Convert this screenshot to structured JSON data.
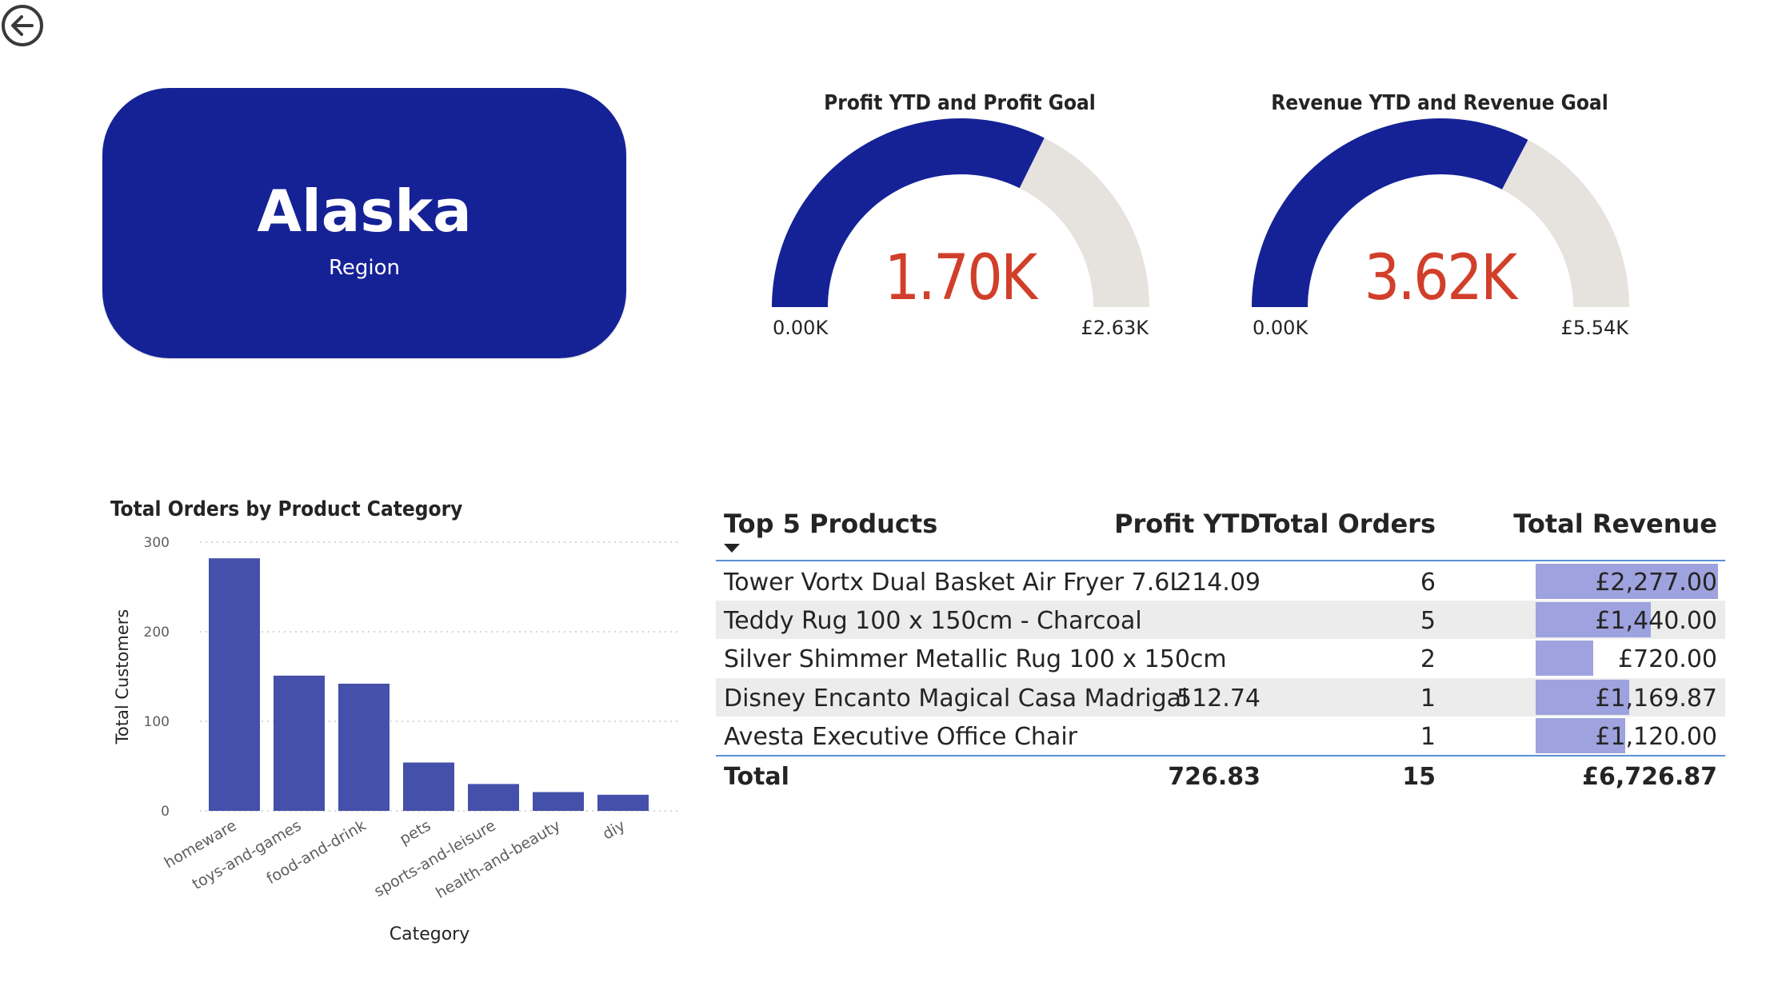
{
  "nav": {
    "back_icon": "back-arrow-icon"
  },
  "region_card": {
    "name": "Alaska",
    "label": "Region",
    "color": "#152296"
  },
  "gauges": [
    {
      "title": "Profit YTD and Profit Goal",
      "value": 1.7,
      "max": 2.63,
      "display": "1.70K",
      "min_label": "0.00K",
      "max_label": "£2.63K"
    },
    {
      "title": "Revenue YTD and Revenue Goal",
      "value": 3.62,
      "max": 5.54,
      "display": "3.62K",
      "min_label": "0.00K",
      "max_label": "£5.54K"
    }
  ],
  "colors": {
    "fill": "#152296",
    "track": "#e6e3df",
    "value_text": "#d13f2a",
    "bar": "#4450aa",
    "table_bar": "#9ea2de"
  },
  "chart_data": {
    "type": "bar",
    "title": "Total Orders by Product Category",
    "xlabel": "Category",
    "ylabel": "Total Customers",
    "categories": [
      "homeware",
      "toys-and-games",
      "food-and-drink",
      "pets",
      "sports-and-leisure",
      "health-and-beauty",
      "diy"
    ],
    "values": [
      282,
      151,
      142,
      54,
      30,
      21,
      18
    ],
    "ylim": [
      0,
      300
    ],
    "yticks": [
      0,
      100,
      200,
      300
    ],
    "grid": true
  },
  "table": {
    "headers": {
      "product": "Top 5 Products",
      "profit": "Profit YTD",
      "orders": "Total Orders",
      "revenue": "Total Revenue"
    },
    "rows": [
      {
        "product": "Tower Vortx Dual Basket Air Fryer 7.6L",
        "profit": "214.09",
        "orders": "6",
        "revenue": "£2,277.00",
        "revenue_value": 2277.0
      },
      {
        "product": "Teddy Rug 100 x 150cm - Charcoal",
        "profit": "",
        "orders": "5",
        "revenue": "£1,440.00",
        "revenue_value": 1440.0
      },
      {
        "product": "Silver Shimmer Metallic Rug 100 x 150cm",
        "profit": "",
        "orders": "2",
        "revenue": "£720.00",
        "revenue_value": 720.0
      },
      {
        "product": "Disney Encanto Magical Casa Madrigal",
        "profit": "512.74",
        "orders": "1",
        "revenue": "£1,169.87",
        "revenue_value": 1169.87
      },
      {
        "product": "Avesta Executive Office Chair",
        "profit": "",
        "orders": "1",
        "revenue": "£1,120.00",
        "revenue_value": 1120.0
      }
    ],
    "total": {
      "label": "Total",
      "profit": "726.83",
      "orders": "15",
      "revenue": "£6,726.87"
    }
  }
}
